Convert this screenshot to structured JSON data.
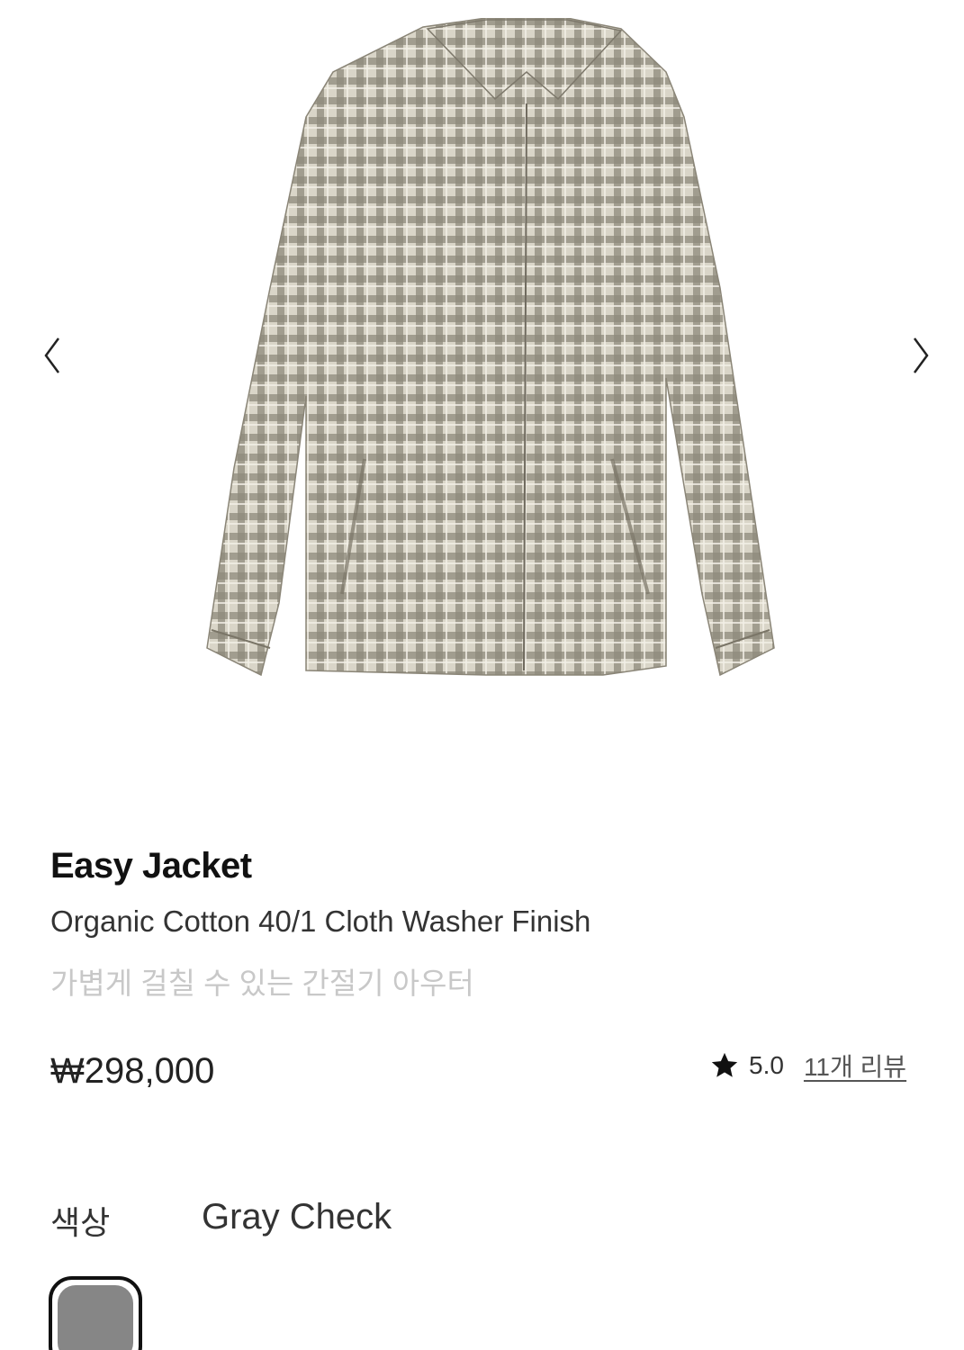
{
  "carousel": {
    "prev_icon": "chevron-left-icon",
    "next_icon": "chevron-right-icon"
  },
  "product": {
    "title": "Easy Jacket",
    "subtitle": "Organic Cotton 40/1 Cloth Washer Finish",
    "description": "가볍게 걸칠 수 있는 간절기 아우터",
    "price": "₩298,000",
    "rating": "5.0",
    "reviews": "11개 리뷰"
  },
  "options": {
    "color_label": "색상",
    "color_value": "Gray Check",
    "swatch_color": "#868686"
  }
}
